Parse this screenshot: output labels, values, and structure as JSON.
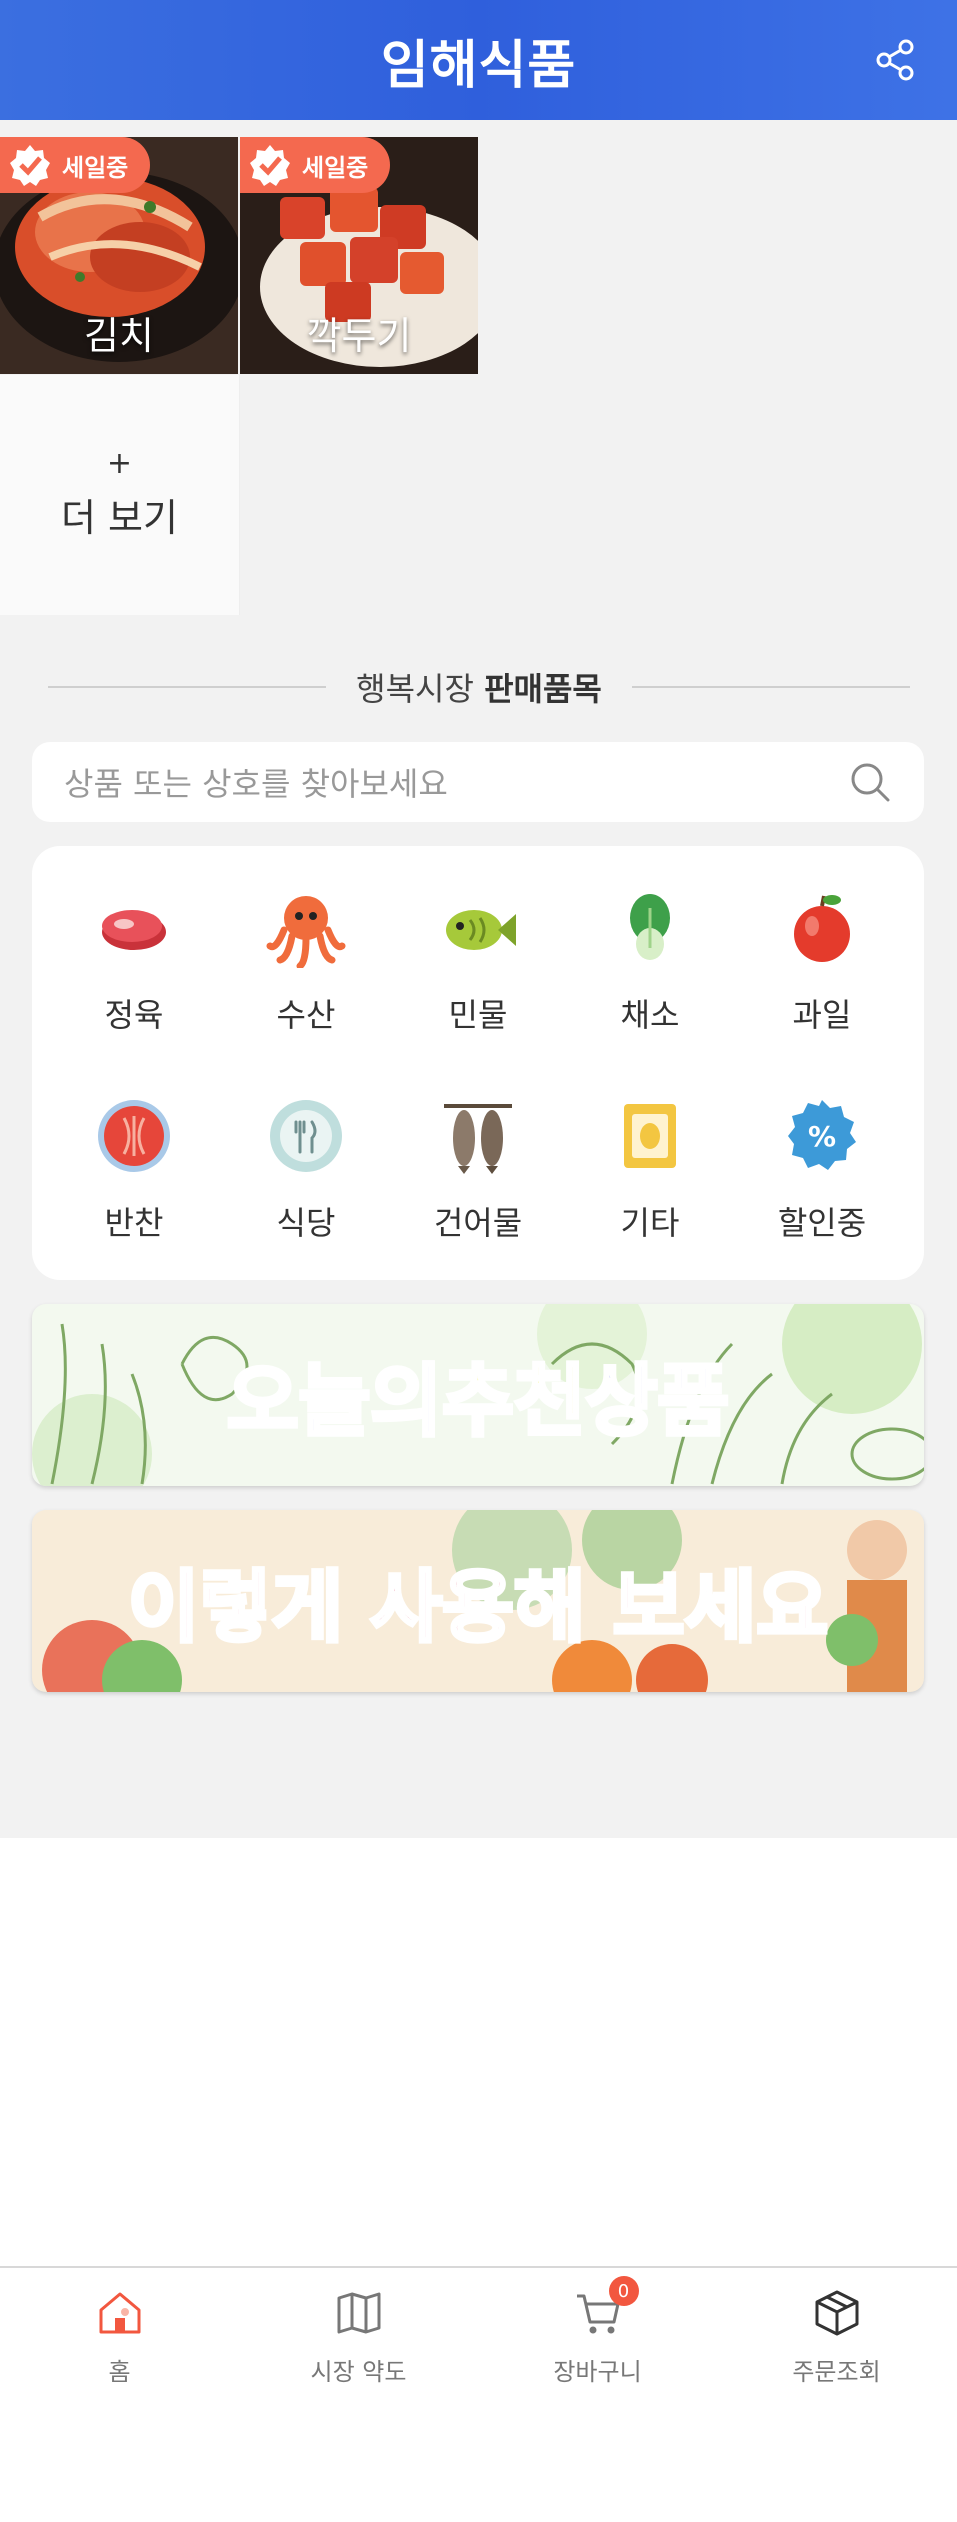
{
  "header": {
    "title": "임해식품",
    "share_icon": "share-icon"
  },
  "products": [
    {
      "name": "김치",
      "badge": "세일중"
    },
    {
      "name": "깍두기",
      "badge": "세일중"
    }
  ],
  "more": {
    "plus": "+",
    "label": "더 보기"
  },
  "section": {
    "title_prefix": "행복시장",
    "title_bold": "판매품목"
  },
  "search": {
    "placeholder": "상품 또는 상호를 찾아보세요"
  },
  "categories": [
    {
      "label": "정육",
      "icon": "meat-icon"
    },
    {
      "label": "수산",
      "icon": "octopus-icon"
    },
    {
      "label": "민물",
      "icon": "fish-icon"
    },
    {
      "label": "채소",
      "icon": "vegetable-icon"
    },
    {
      "label": "과일",
      "icon": "apple-icon"
    },
    {
      "label": "반찬",
      "icon": "side-dish-icon"
    },
    {
      "label": "식당",
      "icon": "restaurant-icon"
    },
    {
      "label": "건어물",
      "icon": "dried-fish-icon"
    },
    {
      "label": "기타",
      "icon": "etc-icon"
    },
    {
      "label": "할인중",
      "icon": "discount-icon"
    }
  ],
  "banners": {
    "recommend": {
      "part1": "오늘의 ",
      "part2": "추천",
      "part3": "상품"
    },
    "howto": {
      "text": "이렇게 사용해 보세요"
    }
  },
  "bottom_nav": {
    "items": [
      {
        "label": "홈",
        "icon": "home-icon",
        "active": true
      },
      {
        "label": "시장 약도",
        "icon": "map-icon"
      },
      {
        "label": "장바구니",
        "icon": "cart-icon",
        "badge": "0"
      },
      {
        "label": "주문조회",
        "icon": "box-icon"
      }
    ]
  },
  "colors": {
    "header": "#3b6fe0",
    "accent": "#f4694f",
    "background": "#f2f2f2"
  }
}
